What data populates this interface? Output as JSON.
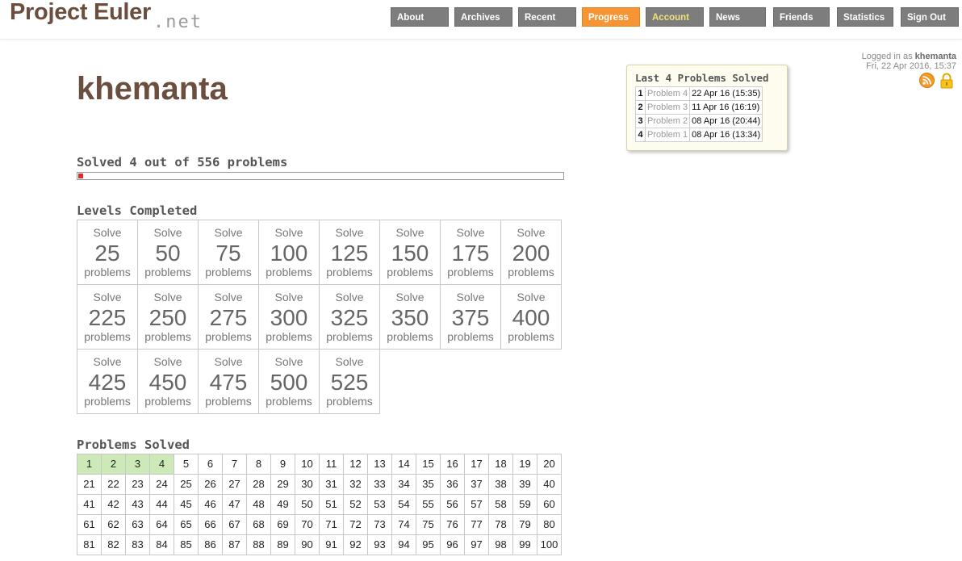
{
  "header": {
    "logo_main": "Project Euler",
    "logo_net": ".net",
    "nav": [
      {
        "label": "About",
        "name": "nav-about",
        "state": "normal"
      },
      {
        "label": "Archives",
        "name": "nav-archives",
        "state": "normal"
      },
      {
        "label": "Recent",
        "name": "nav-recent",
        "state": "normal"
      },
      {
        "label": "Progress",
        "name": "nav-progress",
        "state": "active"
      },
      {
        "label": "Account",
        "name": "nav-account",
        "state": "account"
      },
      {
        "label": "News",
        "name": "nav-news",
        "state": "normal"
      },
      {
        "label": "Friends",
        "name": "nav-friends",
        "state": "normal"
      },
      {
        "label": "Statistics",
        "name": "nav-statistics",
        "state": "normal"
      },
      {
        "label": "Sign Out",
        "name": "nav-sign-out",
        "state": "normal"
      }
    ]
  },
  "login": {
    "prefix": "Logged in as",
    "username": "khemanta",
    "datetime": "Fri, 22 Apr 2016, 15:37",
    "icons": [
      "rss-icon",
      "lock-icon"
    ]
  },
  "recent": {
    "title": "Last 4 Problems Solved",
    "rows": [
      {
        "rank": "1",
        "problem": "Problem 4",
        "date": "22 Apr 16 (15:35)"
      },
      {
        "rank": "2",
        "problem": "Problem 3",
        "date": "11 Apr 16 (16:19)"
      },
      {
        "rank": "3",
        "problem": "Problem 2",
        "date": "08 Apr 16 (20:44)"
      },
      {
        "rank": "4",
        "problem": "Problem 1",
        "date": "08 Apr 16 (13:34)"
      }
    ]
  },
  "profile": {
    "username": "khemanta",
    "solved_title": "Solved 4 out of 556 problems",
    "solved_count": 4,
    "total_count": 556
  },
  "levels": {
    "title": "Levels Completed",
    "solve_word": "Solve",
    "problems_word": "problems",
    "thresholds": [
      "25",
      "50",
      "75",
      "100",
      "125",
      "150",
      "175",
      "200",
      "225",
      "250",
      "275",
      "300",
      "325",
      "350",
      "375",
      "400",
      "425",
      "450",
      "475",
      "500",
      "525"
    ]
  },
  "problems": {
    "title": "Problems Solved",
    "numbers": [
      "1",
      "2",
      "3",
      "4",
      "5",
      "6",
      "7",
      "8",
      "9",
      "10",
      "11",
      "12",
      "13",
      "14",
      "15",
      "16",
      "17",
      "18",
      "19",
      "20",
      "21",
      "22",
      "23",
      "24",
      "25",
      "26",
      "27",
      "28",
      "29",
      "30",
      "31",
      "32",
      "33",
      "34",
      "35",
      "36",
      "37",
      "38",
      "39",
      "40",
      "41",
      "42",
      "43",
      "44",
      "45",
      "46",
      "47",
      "48",
      "49",
      "50",
      "51",
      "52",
      "53",
      "54",
      "55",
      "56",
      "57",
      "58",
      "59",
      "60",
      "61",
      "62",
      "63",
      "64",
      "65",
      "66",
      "67",
      "68",
      "69",
      "70",
      "71",
      "72",
      "73",
      "74",
      "75",
      "76",
      "77",
      "78",
      "79",
      "80",
      "81",
      "82",
      "83",
      "84",
      "85",
      "86",
      "87",
      "88",
      "89",
      "90",
      "91",
      "92",
      "93",
      "94",
      "95",
      "96",
      "97",
      "98",
      "99",
      "100"
    ],
    "solved": [
      "1",
      "2",
      "3",
      "4"
    ]
  },
  "colors": {
    "brand": "#6b4e3d",
    "nav_bg": "#7d7d7d",
    "nav_active": "#f79535",
    "solved_cell": "#cde9b8",
    "progress_fill": "#e52828"
  }
}
